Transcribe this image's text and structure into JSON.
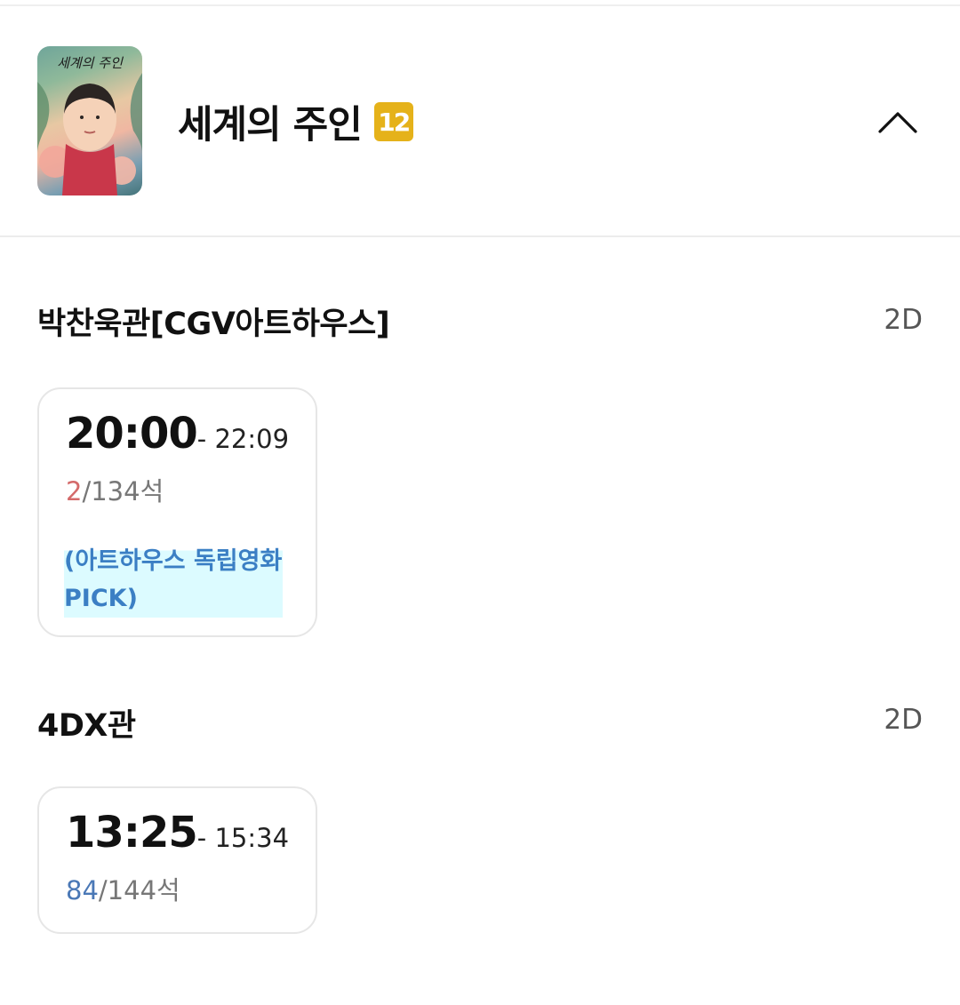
{
  "movie": {
    "title": "세계의 주인",
    "age_rating": "12",
    "poster_title": "세계의 주인",
    "poster_icon": "movie-poster"
  },
  "collapse_icon": "chevron-up-icon",
  "theaters": [
    {
      "name": "박찬욱관[CGV아트하우스]",
      "format": "2D",
      "showtimes": [
        {
          "start": "20:00",
          "end": "- 22:09",
          "seats_available": "2",
          "seats_total": "/134석",
          "promo": "(아트하우스 독립영화 PICK)"
        }
      ]
    },
    {
      "name": "4DX관",
      "format": "2D",
      "showtimes": [
        {
          "start": "13:25",
          "end": "- 15:34",
          "seats_available": "84",
          "seats_total": "/144석"
        }
      ]
    }
  ],
  "colors": {
    "age_badge": "#e5b21a",
    "seats_low": "#d46a6a",
    "seats_ok": "#4a78b6",
    "promo_text": "#3b7fc4",
    "promo_highlight": "#dcfbff"
  }
}
